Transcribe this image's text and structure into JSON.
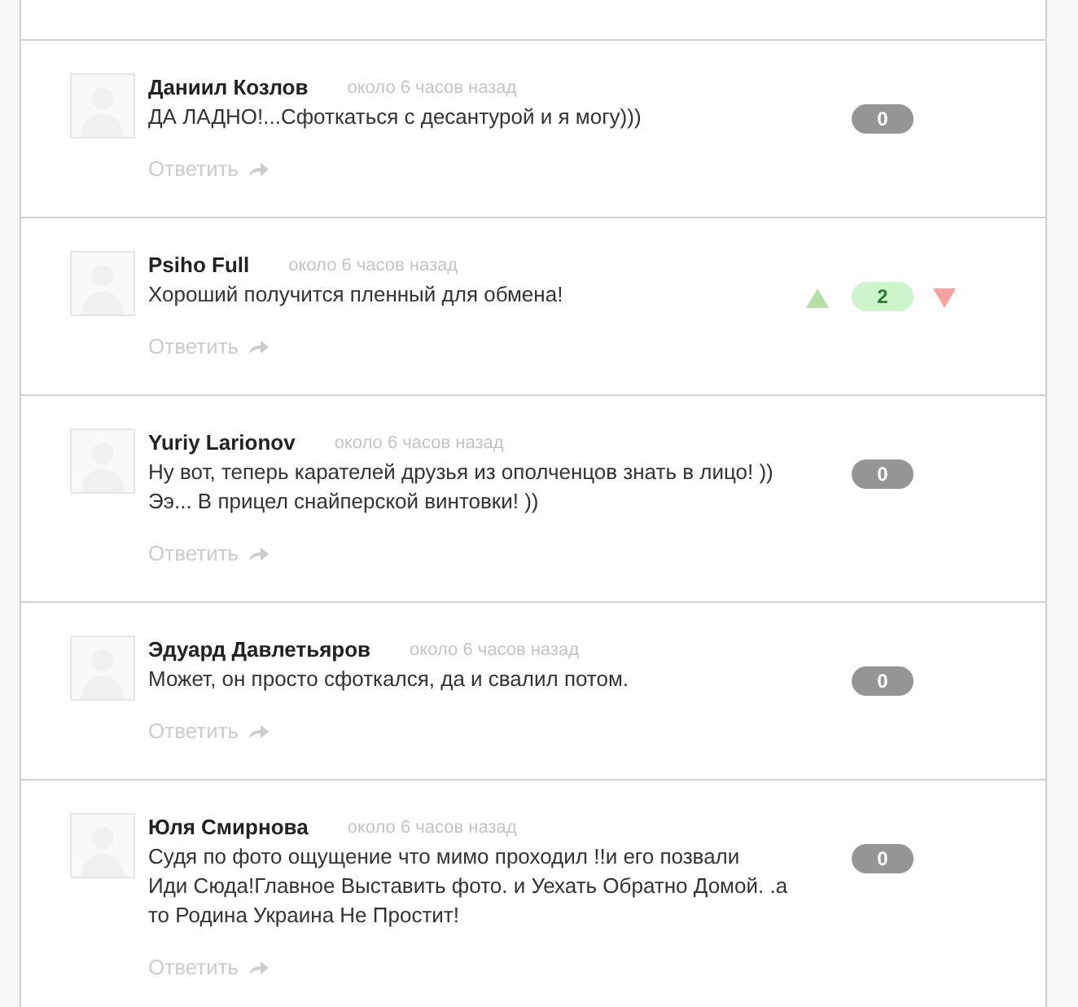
{
  "comments": [
    {
      "author": "Даниил Козлов",
      "time": "около 6 часов назад",
      "text": "ДА ЛАДНО!...Сфоткаться с десантурой и я могу)))",
      "reply": "Ответить",
      "score": "0",
      "kind": "neutral",
      "votes_shown": false
    },
    {
      "author": "Psiho Full",
      "time": "около 6 часов назад",
      "text": "Хороший получится пленный для обмена!",
      "reply": "Ответить",
      "score": "2",
      "kind": "positive",
      "votes_shown": true
    },
    {
      "author": "Yuriy Larionov",
      "time": "около 6 часов назад",
      "text": "Ну вот, теперь карателей друзья из ополченцов знать в лицо! ))\nЭэ... В прицел снайперской винтовки! ))",
      "reply": "Ответить",
      "score": "0",
      "kind": "neutral",
      "votes_shown": false
    },
    {
      "author": "Эдуард Давлетьяров",
      "time": "около 6 часов назад",
      "text": "Может, он просто сфоткался, да и свалил потом.",
      "reply": "Ответить",
      "score": "0",
      "kind": "neutral",
      "votes_shown": false
    },
    {
      "author": "Юля Смирнова",
      "time": "около 6 часов назад",
      "text": "Судя по фото ощущение что мимо проходил !!и его позвали\nИди Сюда!Главное Выставить фото. и Уехать Обратно Домой. .а\nто Родина Украина Не Простит!",
      "reply": "Ответить",
      "score": "0",
      "kind": "neutral",
      "votes_shown": false
    }
  ]
}
